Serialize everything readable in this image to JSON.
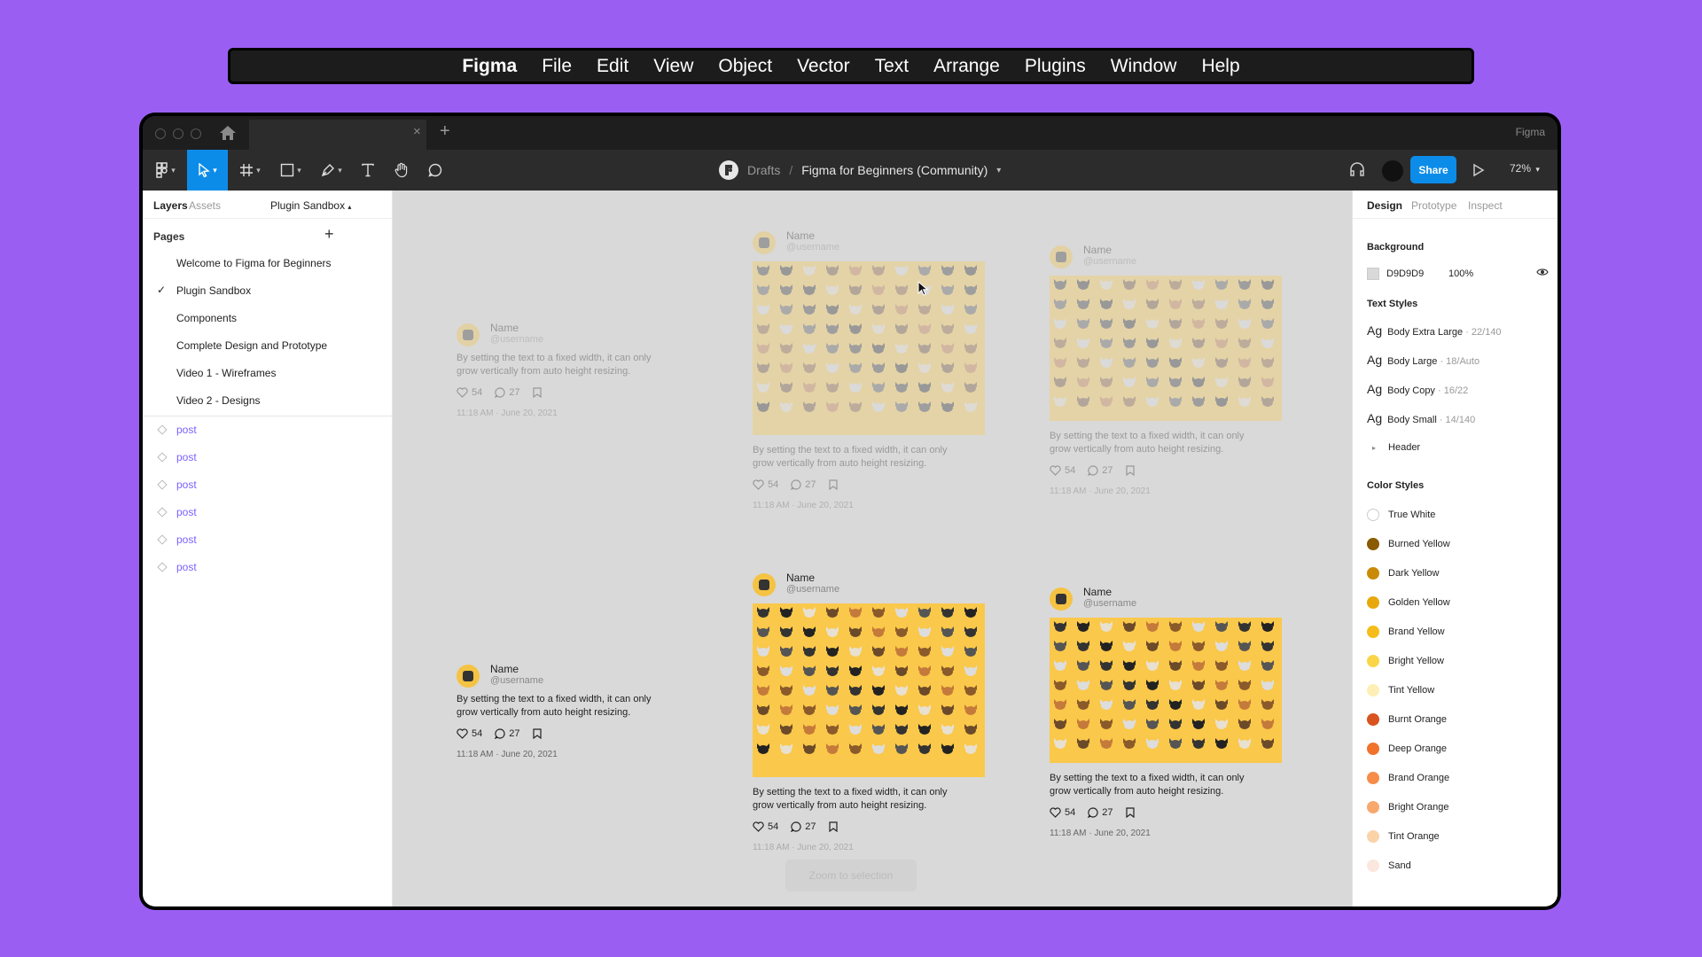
{
  "menubar": {
    "items": [
      "Figma",
      "File",
      "Edit",
      "View",
      "Object",
      "Vector",
      "Text",
      "Arrange",
      "Plugins",
      "Window",
      "Help"
    ]
  },
  "tabbar": {
    "app_name": "Figma",
    "close_glyph": "×",
    "add_glyph": "+"
  },
  "toolbar": {
    "breadcrumb_drafts": "Drafts",
    "breadcrumb_sep": "/",
    "file_name": "Figma for Beginners (Community)",
    "share_label": "Share",
    "zoom_label": "72%"
  },
  "left_panel": {
    "tab_layers": "Layers",
    "tab_assets": "Assets",
    "current_page": "Plugin Sandbox",
    "pages_title": "Pages",
    "pages": [
      "Welcome to Figma for Beginners",
      "Plugin Sandbox",
      "Components",
      "Complete Design and Prototype",
      "Video 1 - Wireframes",
      "Video 2 - Designs"
    ],
    "layers": [
      "post",
      "post",
      "post",
      "post",
      "post",
      "post"
    ]
  },
  "canvas": {
    "post": {
      "name": "Name",
      "username": "@username",
      "text": "By setting the text to a fixed width, it can only grow vertically from auto height resizing.",
      "likes": "54",
      "comments": "27",
      "time": "11:18 AM · June 20, 2021"
    },
    "zoom_toast": "Zoom to selection"
  },
  "right_panel": {
    "tab_design": "Design",
    "tab_prototype": "Prototype",
    "tab_inspect": "Inspect",
    "background_title": "Background",
    "background_hex": "D9D9D9",
    "background_opacity": "100%",
    "text_styles_title": "Text Styles",
    "text_styles": [
      {
        "name": "Body Extra Large",
        "meta": "22/140"
      },
      {
        "name": "Body Large",
        "meta": "18/Auto"
      },
      {
        "name": "Body Copy",
        "meta": "16/22"
      },
      {
        "name": "Body Small",
        "meta": "14/140"
      }
    ],
    "ag_label": "Ag",
    "header_group": "Header",
    "color_styles_title": "Color Styles",
    "color_styles": [
      {
        "name": "True White",
        "color": "#ffffff"
      },
      {
        "name": "Burned Yellow",
        "color": "#8a5a00"
      },
      {
        "name": "Dark Yellow",
        "color": "#c98a07"
      },
      {
        "name": "Golden Yellow",
        "color": "#e8a80c"
      },
      {
        "name": "Brand Yellow",
        "color": "#f5bc1b"
      },
      {
        "name": "Bright Yellow",
        "color": "#fbd548"
      },
      {
        "name": "Tint Yellow",
        "color": "#fdefb5"
      },
      {
        "name": "Burnt Orange",
        "color": "#d9531e"
      },
      {
        "name": "Deep Orange",
        "color": "#f0722b"
      },
      {
        "name": "Brand Orange",
        "color": "#f68c47"
      },
      {
        "name": "Bright Orange",
        "color": "#f7a86d"
      },
      {
        "name": "Tint Orange",
        "color": "#fbd3a8"
      },
      {
        "name": "Sand",
        "color": "#fbe7dd"
      }
    ],
    "help_label": "?"
  }
}
